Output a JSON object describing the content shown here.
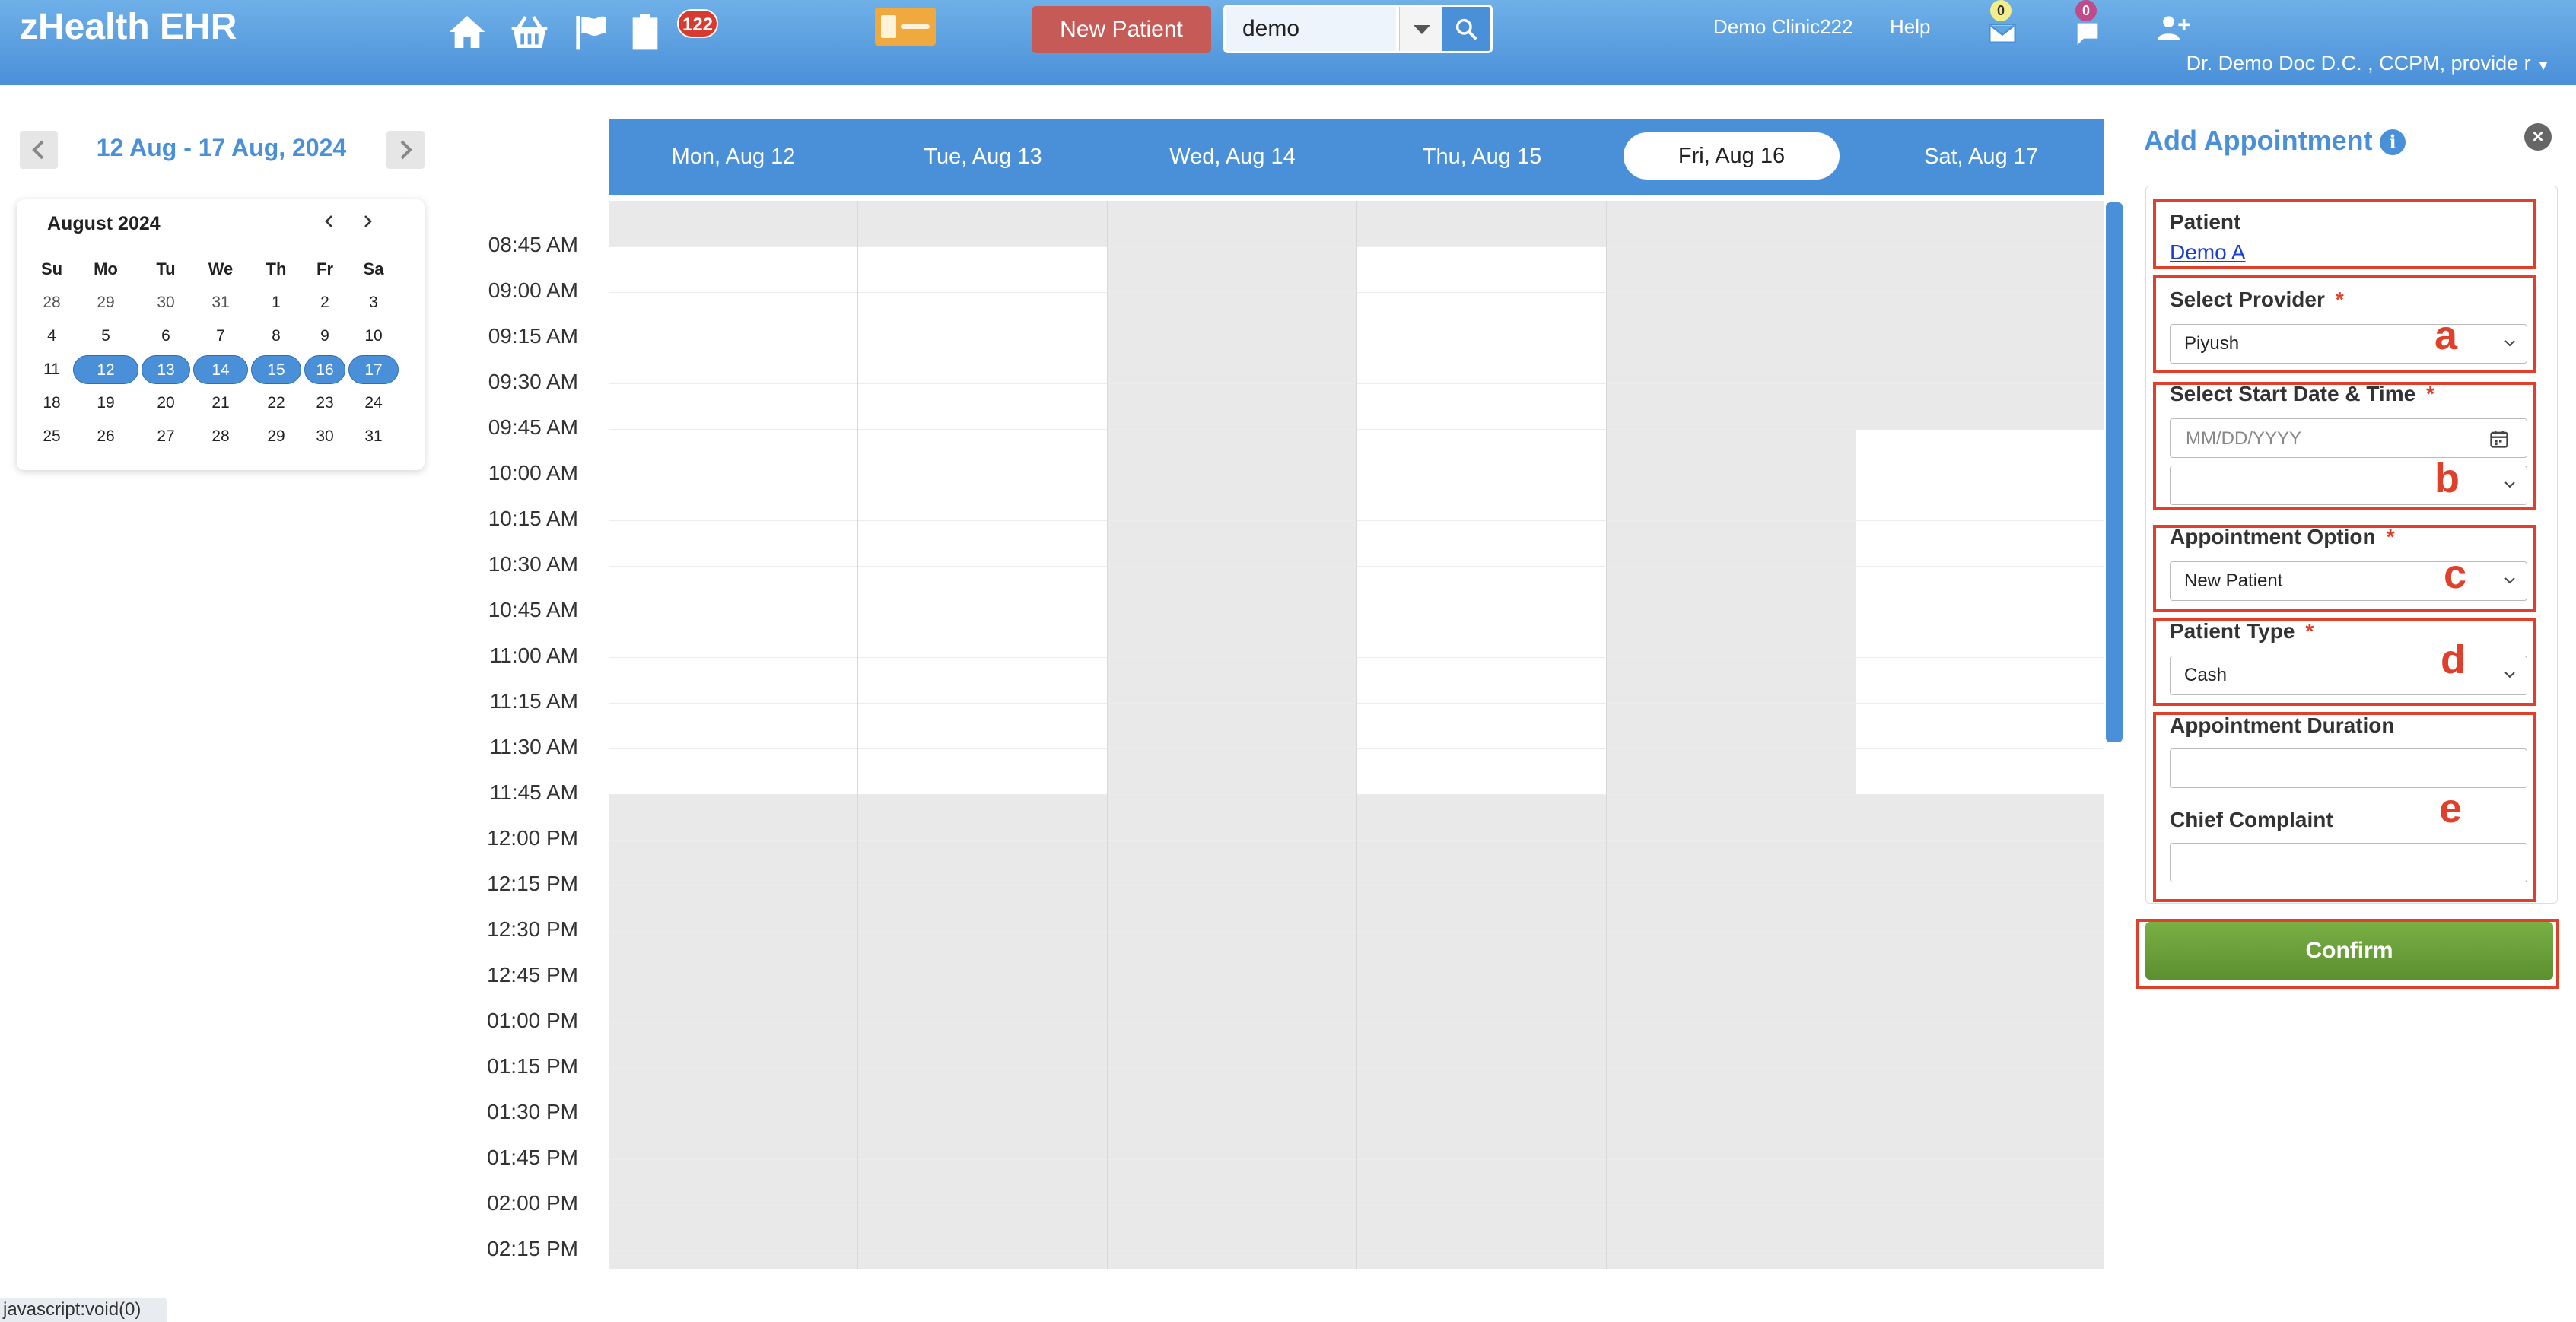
{
  "app": {
    "title": "zHealth EHR"
  },
  "topbar": {
    "notification_count": "122",
    "new_patient_label": "New Patient",
    "search_value": "demo",
    "clinic": "Demo Clinic222",
    "help": "Help",
    "mail_count": "0",
    "chat_count": "0",
    "user": "Dr. Demo Doc D.C. , CCPM, provide r"
  },
  "range": {
    "title": "12 Aug - 17 Aug, 2024"
  },
  "mini_calendar": {
    "title": "August 2024",
    "weekdays": [
      "Su",
      "Mo",
      "Tu",
      "We",
      "Th",
      "Fr",
      "Sa"
    ],
    "weeks": [
      [
        "28",
        "29",
        "30",
        "31",
        "1",
        "2",
        "3"
      ],
      [
        "4",
        "5",
        "6",
        "7",
        "8",
        "9",
        "10"
      ],
      [
        "11",
        "12",
        "13",
        "14",
        "15",
        "16",
        "17"
      ],
      [
        "18",
        "19",
        "20",
        "21",
        "22",
        "23",
        "24"
      ],
      [
        "25",
        "26",
        "27",
        "28",
        "29",
        "30",
        "31"
      ]
    ],
    "selected": [
      "12",
      "13",
      "14",
      "15",
      "16",
      "17"
    ]
  },
  "calendar": {
    "days": [
      "Mon, Aug 12",
      "Tue, Aug 13",
      "Wed, Aug 14",
      "Thu, Aug 15",
      "Fri, Aug 16",
      "Sat, Aug 17"
    ],
    "active_day": "Fri, Aug 16",
    "times": [
      "08:45 AM",
      "09:00 AM",
      "09:15 AM",
      "09:30 AM",
      "09:45 AM",
      "10:00 AM",
      "10:15 AM",
      "10:30 AM",
      "10:45 AM",
      "11:00 AM",
      "11:15 AM",
      "11:30 AM",
      "11:45 AM",
      "12:00 PM",
      "12:15 PM",
      "12:30 PM",
      "12:45 PM",
      "01:00 PM",
      "01:15 PM",
      "01:30 PM",
      "01:45 PM",
      "02:00 PM",
      "02:15 PM"
    ]
  },
  "form": {
    "title": "Add Appointment",
    "patient_label": "Patient",
    "patient_value": "Demo A",
    "provider_label": "Select Provider",
    "provider_value": "Piyush",
    "start_label": "Select Start Date & Time",
    "date_placeholder": "MM/DD/YYYY",
    "option_label": "Appointment Option",
    "option_value": "New Patient",
    "type_label": "Patient Type",
    "type_value": "Cash",
    "duration_label": "Appointment Duration",
    "complaint_label": "Chief Complaint",
    "required_mark": "*",
    "confirm_label": "Confirm",
    "annotations": [
      "a",
      "b",
      "c",
      "d",
      "e"
    ]
  },
  "statusbar": {
    "text": "javascript:void(0)"
  },
  "colors": {
    "brand_blue": "#4a90d9",
    "highlight_red": "#e0402a",
    "confirm_green": "#6a9e3a",
    "new_patient_red": "#c55a56"
  }
}
